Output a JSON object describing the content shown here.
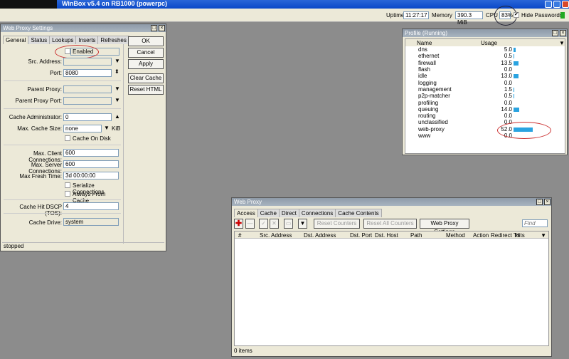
{
  "app": {
    "title": "WinBox v5.4 on RB1000 (powerpc)"
  },
  "topbar": {
    "uptime_label": "Uptime",
    "uptime": "11:27:17",
    "memory_label": "Memory",
    "memory": "390.3 MiB",
    "cpu_label": "CPU",
    "cpu": "83%",
    "hide_passwords": "Hide Passwords"
  },
  "settings": {
    "title": "Web Proxy Settings",
    "tabs": [
      "General",
      "Status",
      "Lookups",
      "Inserts",
      "Refreshes"
    ],
    "enabled": "Enabled",
    "src_address": "Src. Address:",
    "port_label": "Port:",
    "port": "8080",
    "parent_proxy": "Parent Proxy:",
    "parent_proxy_port": "Parent Proxy Port:",
    "cache_admin_label": "Cache Administrator:",
    "cache_admin": "0",
    "max_cache_label": "Max. Cache Size:",
    "max_cache": "none",
    "kib": "KiB",
    "cache_on_disk": "Cache On Disk",
    "max_client_label": "Max. Client Connections:",
    "max_client": "600",
    "max_server_label": "Max. Server Connections:",
    "max_server": "600",
    "fresh_label": "Max Fresh Time:",
    "fresh": "3d 00:00:00",
    "serialize": "Serialize Connections",
    "always_cache": "Always From Cache",
    "dscp_label": "Cache Hit DSCP (TOS):",
    "dscp": "4",
    "drive_label": "Cache Drive:",
    "drive": "system",
    "buttons": {
      "ok": "OK",
      "cancel": "Cancel",
      "apply": "Apply",
      "clear": "Clear Cache",
      "reset": "Reset HTML"
    },
    "status": "stopped"
  },
  "profile": {
    "title": "Profile (Running)",
    "col_name": "Name",
    "col_usage": "Usage",
    "rows": [
      {
        "name": "dns",
        "usage": "5.0",
        "v": 5.0
      },
      {
        "name": "ethernet",
        "usage": "0.5",
        "v": 0.5
      },
      {
        "name": "firewall",
        "usage": "13.5",
        "v": 13.5
      },
      {
        "name": "flash",
        "usage": "0.0",
        "v": 0
      },
      {
        "name": "idle",
        "usage": "13.0",
        "v": 13.0
      },
      {
        "name": "logging",
        "usage": "0.0",
        "v": 0
      },
      {
        "name": "management",
        "usage": "1.5",
        "v": 1.5
      },
      {
        "name": "p2p-matcher",
        "usage": "0.5",
        "v": 0.5
      },
      {
        "name": "profiling",
        "usage": "0.0",
        "v": 0
      },
      {
        "name": "queuing",
        "usage": "14.0",
        "v": 14.0
      },
      {
        "name": "routing",
        "usage": "0.0",
        "v": 0
      },
      {
        "name": "unclassified",
        "usage": "0.0",
        "v": 0
      },
      {
        "name": "web-proxy",
        "usage": "52.0",
        "v": 52.0
      },
      {
        "name": "www",
        "usage": "0.0",
        "v": 0
      }
    ]
  },
  "webproxy": {
    "title": "Web Proxy",
    "tabs": [
      "Access",
      "Cache",
      "Direct",
      "Connections",
      "Cache Contents"
    ],
    "reset_counters": "Reset Counters",
    "reset_all": "Reset All Counters",
    "settings_btn": "Web Proxy Settings",
    "find_placeholder": "Find",
    "columns": [
      "#",
      "Src. Address",
      "Dst. Address",
      "Dst. Port",
      "Dst. Host",
      "Path",
      "Method",
      "Action",
      "Redirect To",
      "Hits"
    ],
    "status": "0 items"
  }
}
